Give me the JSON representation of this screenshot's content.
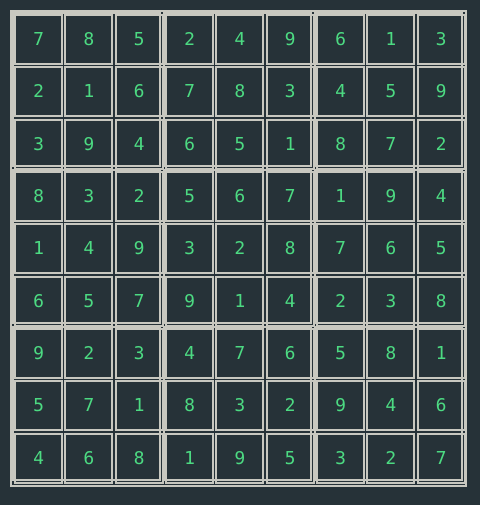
{
  "board": {
    "rows": [
      [
        "7",
        "8",
        "5",
        "2",
        "4",
        "9",
        "6",
        "1",
        "3"
      ],
      [
        "2",
        "1",
        "6",
        "7",
        "8",
        "3",
        "4",
        "5",
        "9"
      ],
      [
        "3",
        "9",
        "4",
        "6",
        "5",
        "1",
        "8",
        "7",
        "2"
      ],
      [
        "8",
        "3",
        "2",
        "5",
        "6",
        "7",
        "1",
        "9",
        "4"
      ],
      [
        "1",
        "4",
        "9",
        "3",
        "2",
        "8",
        "7",
        "6",
        "5"
      ],
      [
        "6",
        "5",
        "7",
        "9",
        "1",
        "4",
        "2",
        "3",
        "8"
      ],
      [
        "9",
        "2",
        "3",
        "4",
        "7",
        "6",
        "5",
        "8",
        "1"
      ],
      [
        "5",
        "7",
        "1",
        "8",
        "3",
        "2",
        "9",
        "4",
        "6"
      ],
      [
        "4",
        "6",
        "8",
        "1",
        "9",
        "5",
        "3",
        "2",
        "7"
      ]
    ]
  },
  "colors": {
    "background": "#263238",
    "grid_line": "#c8c8c0",
    "digit": "#4cda82"
  }
}
